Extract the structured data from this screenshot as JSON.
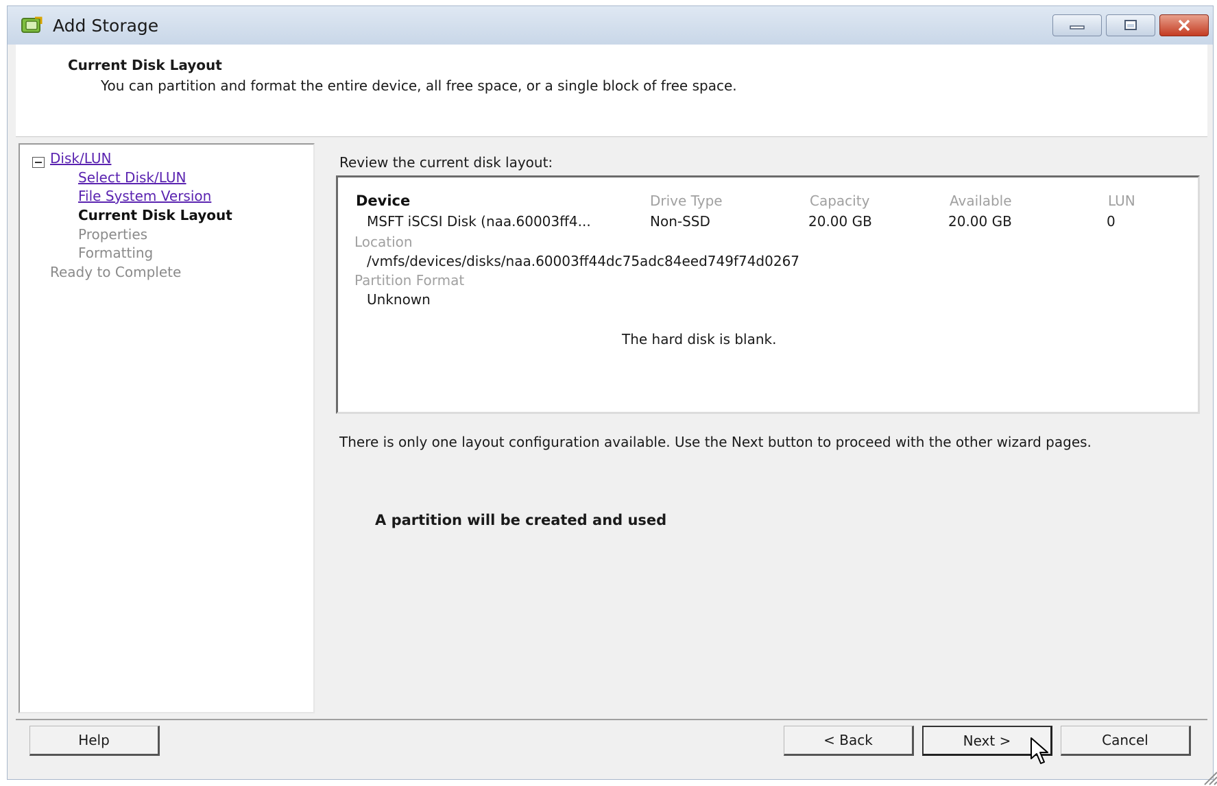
{
  "window": {
    "title": "Add Storage"
  },
  "header": {
    "title": "Current Disk Layout",
    "subtitle": "You can partition and format the entire device, all free space, or a single block of free space."
  },
  "nav": {
    "items": [
      {
        "label": "Disk/LUN",
        "state": "link"
      },
      {
        "label": "Select Disk/LUN",
        "state": "link"
      },
      {
        "label": "File System Version",
        "state": "link"
      },
      {
        "label": "Current Disk Layout",
        "state": "current"
      },
      {
        "label": "Properties",
        "state": "disabled"
      },
      {
        "label": "Formatting",
        "state": "disabled"
      },
      {
        "label": "Ready to Complete",
        "state": "disabled"
      }
    ]
  },
  "main": {
    "review_label": "Review the current disk layout:",
    "columns": [
      "Device",
      "Drive Type",
      "Capacity",
      "Available",
      "LUN"
    ],
    "row": {
      "device": "MSFT iSCSI Disk (naa.60003ff4...",
      "drive_type": "Non-SSD",
      "capacity": "20.00 GB",
      "available": "20.00 GB",
      "lun": "0"
    },
    "location_label": "Location",
    "location_value": "/vmfs/devices/disks/naa.60003ff44dc75adc84eed749f74d0267",
    "partition_label": "Partition Format",
    "partition_value": "Unknown",
    "blank_message": "The hard disk is blank.",
    "info_text": "There is only one layout configuration available. Use the Next button to proceed with the other wizard pages.",
    "partition_notice": "A partition will be created and used"
  },
  "footer": {
    "help": "Help",
    "back": "< Back",
    "next": "Next >",
    "cancel": "Cancel"
  },
  "icons": {
    "app": "storage-wizard-icon",
    "cursor": "mouse-pointer-icon"
  },
  "colors": {
    "link": "#5a23b0",
    "close_button": "#c43c22"
  }
}
